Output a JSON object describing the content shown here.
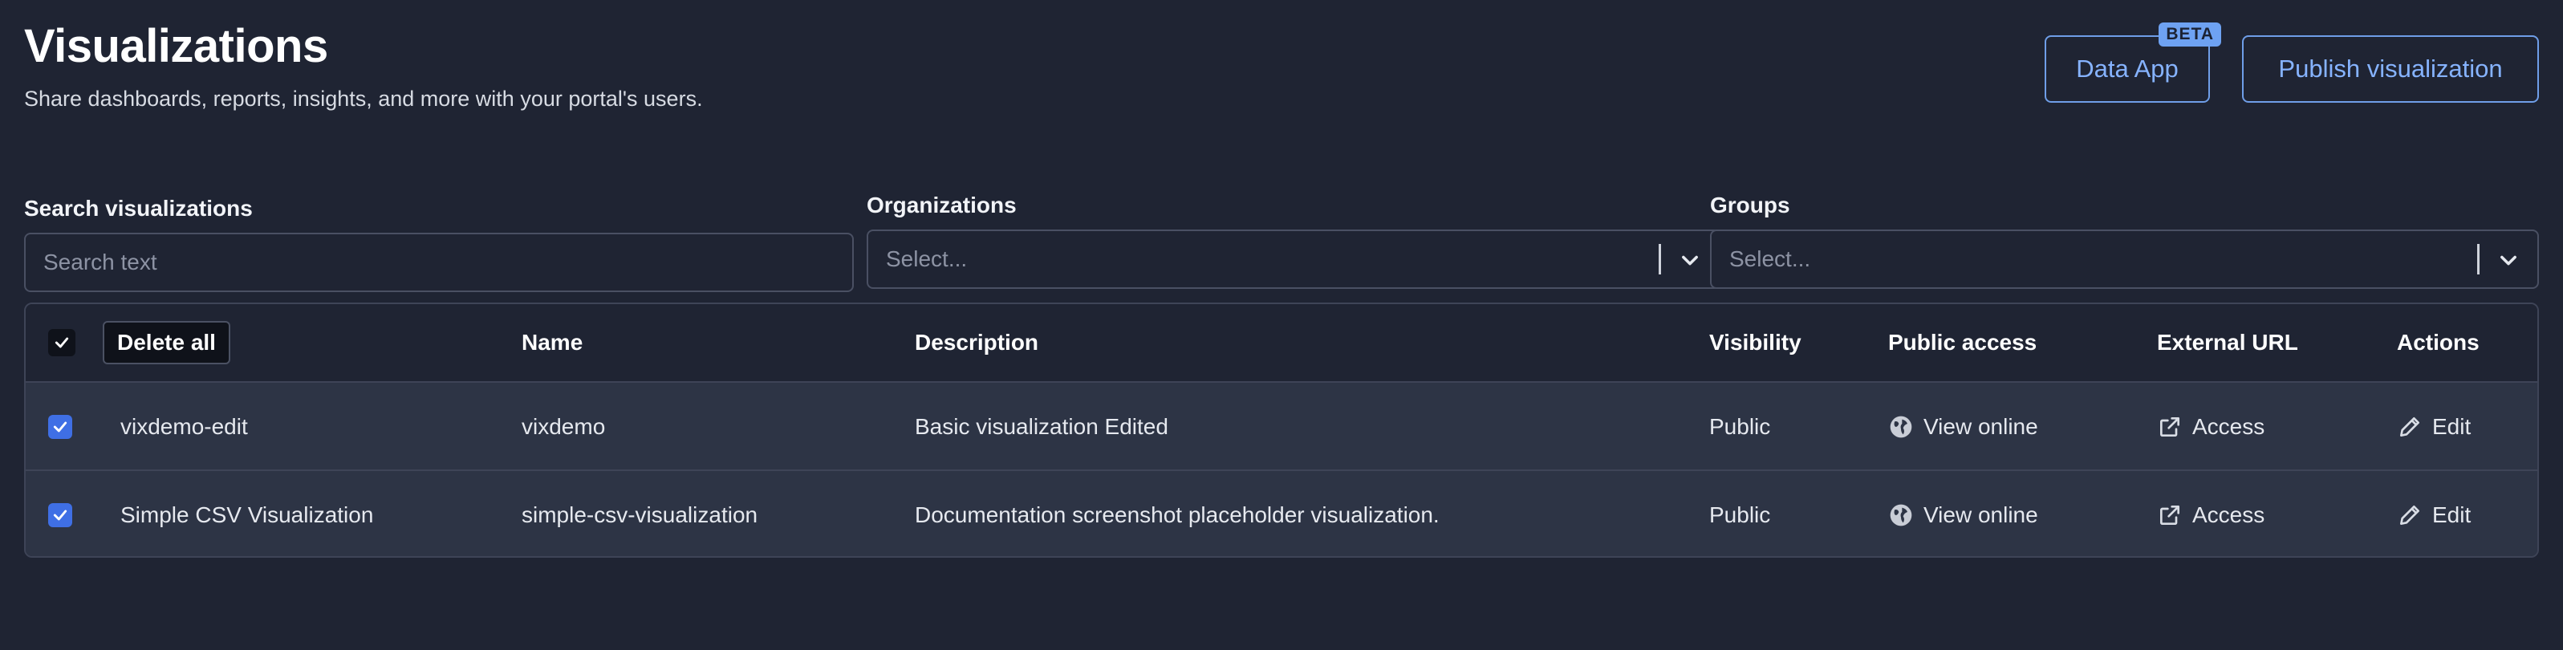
{
  "header": {
    "title": "Visualizations",
    "subtitle": "Share dashboards, reports, insights, and more with your portal's users."
  },
  "actions": {
    "data_app_label": "Data App",
    "beta_label": "BETA",
    "publish_label": "Publish visualization"
  },
  "filters": {
    "search": {
      "label": "Search visualizations",
      "placeholder": "Search text"
    },
    "organizations": {
      "label": "Organizations",
      "placeholder": "Select..."
    },
    "groups": {
      "label": "Groups",
      "placeholder": "Select..."
    }
  },
  "table": {
    "delete_all_label": "Delete all",
    "columns": {
      "name": "Name",
      "description": "Description",
      "visibility": "Visibility",
      "public_access": "Public access",
      "external_url": "External URL",
      "actions": "Actions"
    },
    "rows": [
      {
        "title": "vixdemo-edit",
        "name": "vixdemo",
        "description": "Basic visualization Edited",
        "visibility": "Public",
        "public_access": "View online",
        "external_url": "Access",
        "action": "Edit"
      },
      {
        "title": "Simple CSV Visualization",
        "name": "simple-csv-visualization",
        "description": "Documentation screenshot placeholder visualization.",
        "visibility": "Public",
        "public_access": "View online",
        "external_url": "Access",
        "action": "Edit"
      }
    ]
  },
  "colors": {
    "background": "#1f2433",
    "accent": "#86b3ff",
    "checkbox": "#3f6fe5",
    "row_bg": "#2d3445"
  },
  "icons": [
    "globe-icon",
    "external-link-icon",
    "pencil-icon",
    "chevron-down-icon",
    "check-icon"
  ]
}
